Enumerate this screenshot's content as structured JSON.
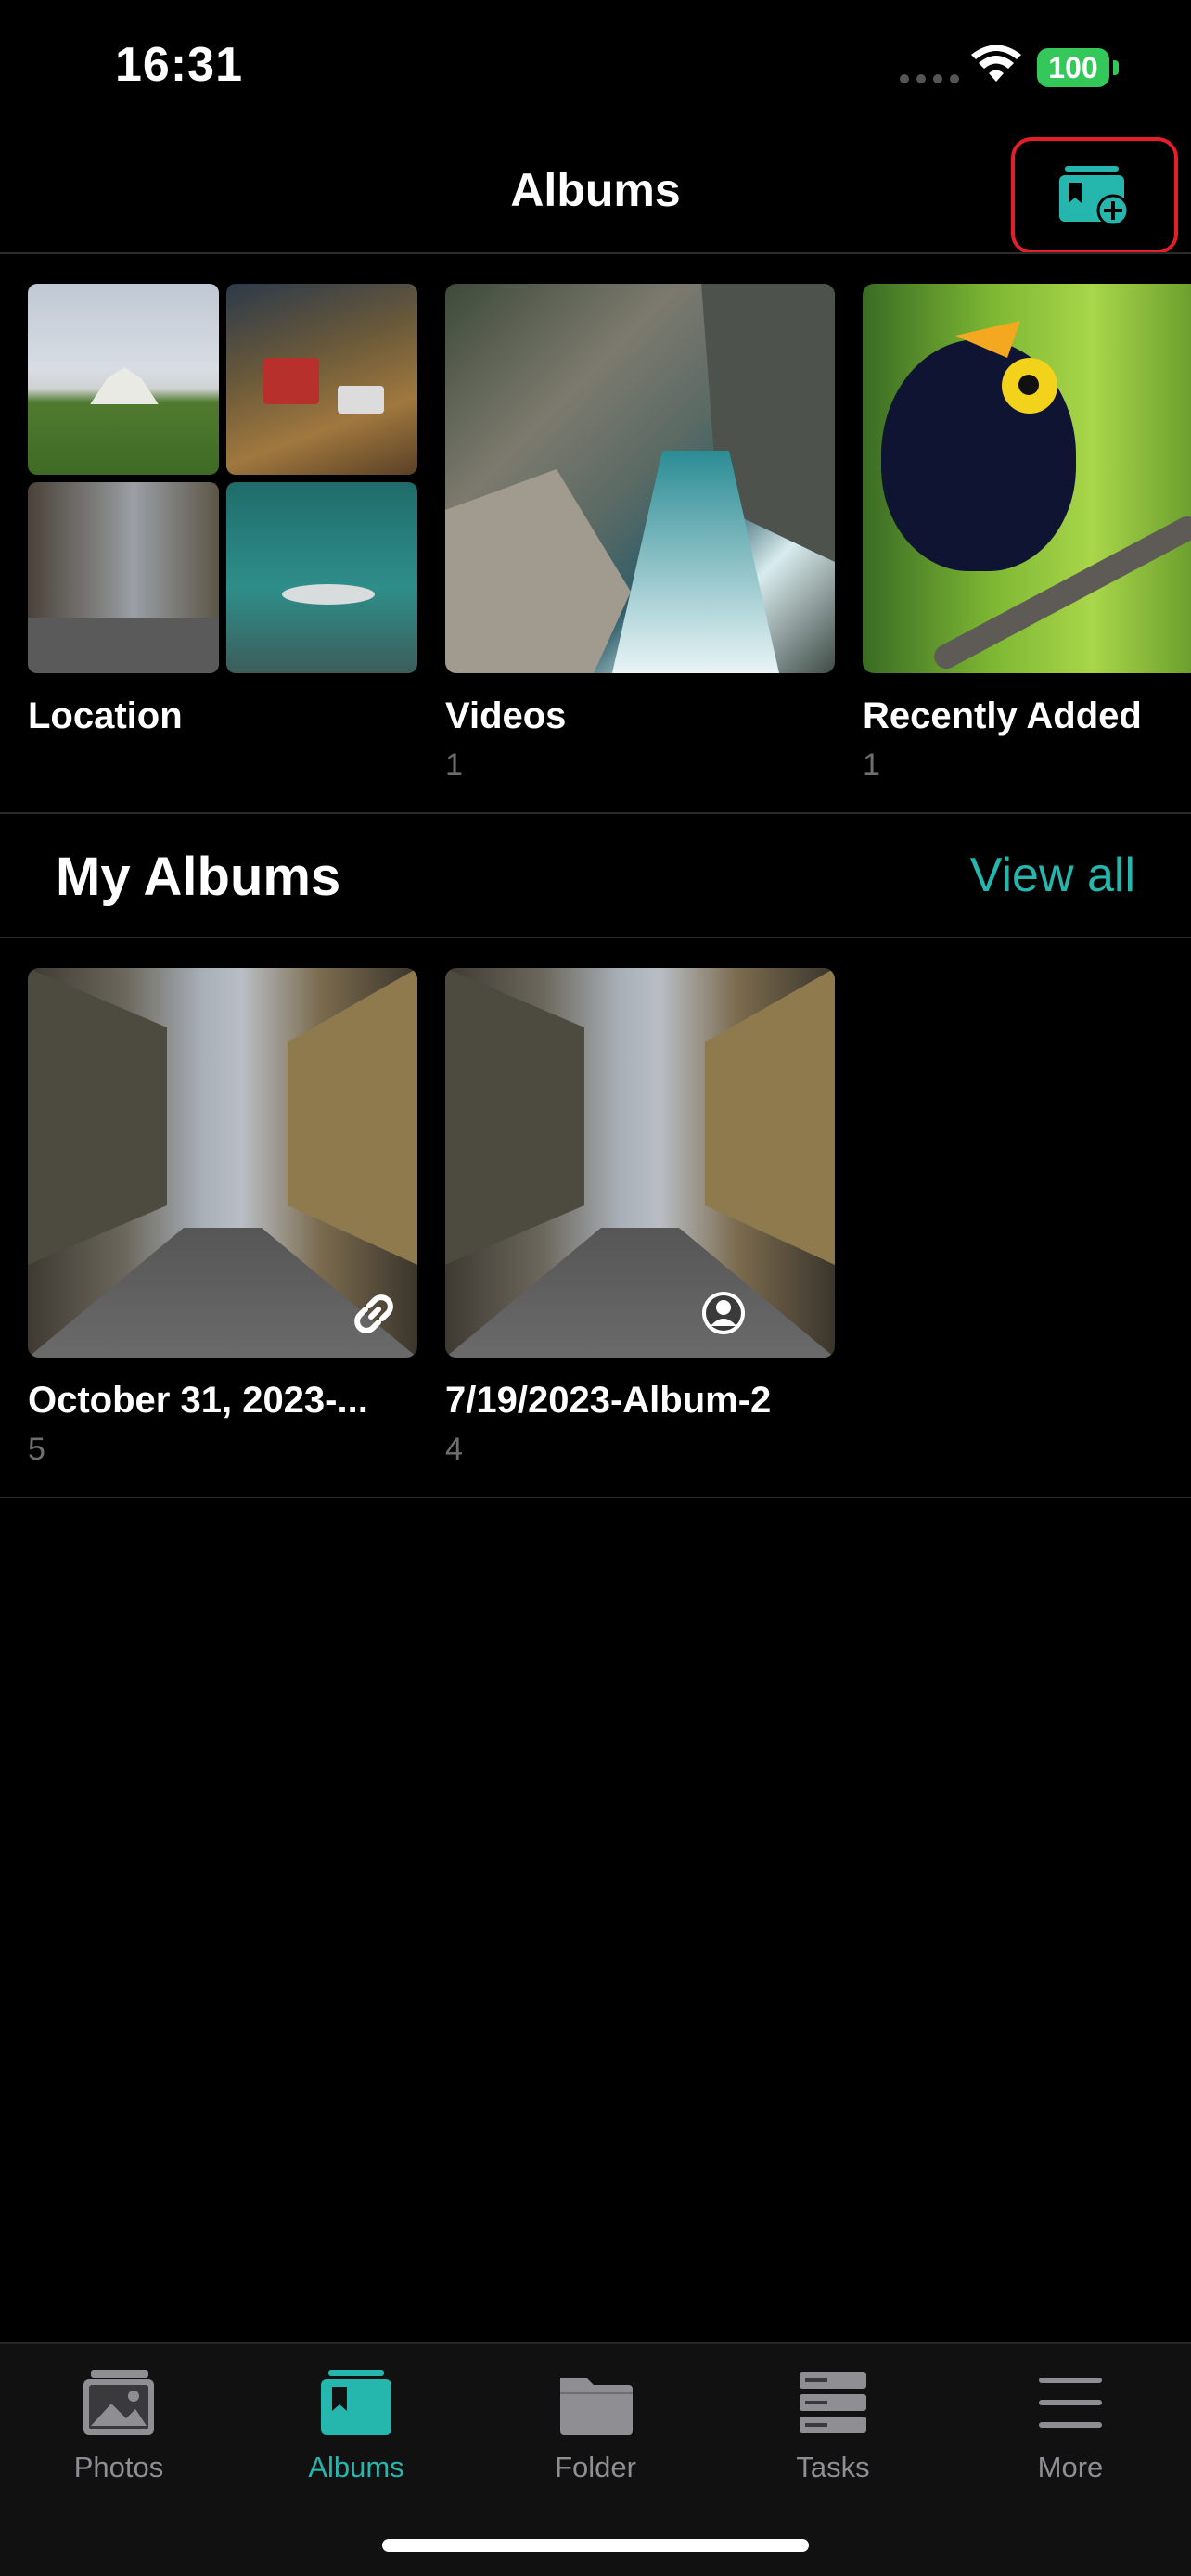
{
  "status_bar": {
    "time": "16:31",
    "battery": "100"
  },
  "header": {
    "title": "Albums",
    "add_button_icon": "add-album-icon"
  },
  "top_albums": [
    {
      "label": "Location",
      "count": ""
    },
    {
      "label": "Videos",
      "count": "1"
    },
    {
      "label": "Recently Added",
      "count": "1"
    }
  ],
  "my_albums": {
    "title": "My Albums",
    "view_all": "View all",
    "items": [
      {
        "label": "October 31, 2023-...",
        "count": "5",
        "badge_icon": "link-icon"
      },
      {
        "label": "7/19/2023-Album-2",
        "count": "4",
        "badge_icon": "person-icon"
      }
    ]
  },
  "tabbar": {
    "items": [
      {
        "label": "Photos",
        "icon": "photos-icon"
      },
      {
        "label": "Albums",
        "icon": "albums-icon",
        "active": true
      },
      {
        "label": "Folder",
        "icon": "folder-icon"
      },
      {
        "label": "Tasks",
        "icon": "tasks-icon"
      },
      {
        "label": "More",
        "icon": "menu-icon"
      }
    ]
  },
  "colors": {
    "accent": "#25b6ad",
    "highlight_border": "#e41e2b",
    "battery": "#34c759"
  }
}
